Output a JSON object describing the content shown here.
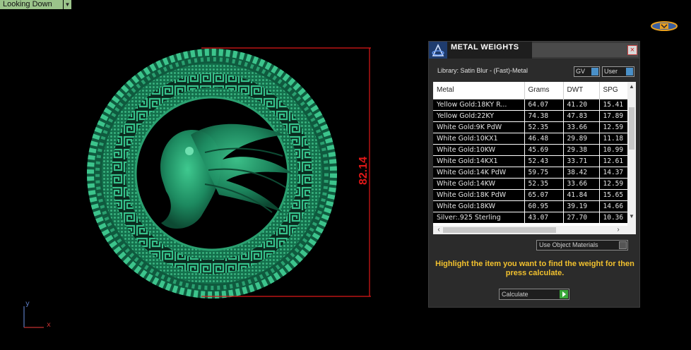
{
  "viewport": {
    "view_label": "Looking Down",
    "dimension_value": "82.14",
    "axis_y": "y",
    "axis_x": "x"
  },
  "panel": {
    "title": "METAL WEIGHTS",
    "close_glyph": "×",
    "library": "Library: Satin Blur - (Fast)-Metal",
    "gv_label": "GV",
    "user_label": "User",
    "columns": [
      "Metal",
      "Grams",
      "DWT",
      "SPG"
    ],
    "rows": [
      [
        "Yellow Gold:18KY R...",
        "64.07",
        "41.20",
        "15.41"
      ],
      [
        "Yellow Gold:22KY",
        "74.38",
        "47.83",
        "17.89"
      ],
      [
        "White Gold:9K PdW",
        "52.35",
        "33.66",
        "12.59"
      ],
      [
        "White Gold:10KX1",
        "46.48",
        "29.89",
        "11.18"
      ],
      [
        "White Gold:10KW",
        "45.69",
        "29.38",
        "10.99"
      ],
      [
        "White Gold:14KX1",
        "52.43",
        "33.71",
        "12.61"
      ],
      [
        "White Gold:14K PdW",
        "59.75",
        "38.42",
        "14.37"
      ],
      [
        "White Gold:14KW",
        "52.35",
        "33.66",
        "12.59"
      ],
      [
        "White Gold:18K PdW",
        "65.07",
        "41.84",
        "15.65"
      ],
      [
        "White Gold:18KW",
        "60.95",
        "39.19",
        "14.66"
      ],
      [
        "Silver:.925 Sterling",
        "43.07",
        "27.70",
        "10.36"
      ]
    ],
    "use_object_materials": "Use Object Materials",
    "hint": "Highlight the item you want to find the weight for then press calculate.",
    "calculate": "Calculate"
  },
  "colors": {
    "medallion": "#1f8a62",
    "dimension": "#e01818",
    "hint": "#f2c12e",
    "view_label_bg": "#9bc48a"
  },
  "icons": [
    "chevron-down-icon",
    "logo-badge-icon",
    "close-icon",
    "app-logo-icon",
    "play-arrow-icon"
  ]
}
